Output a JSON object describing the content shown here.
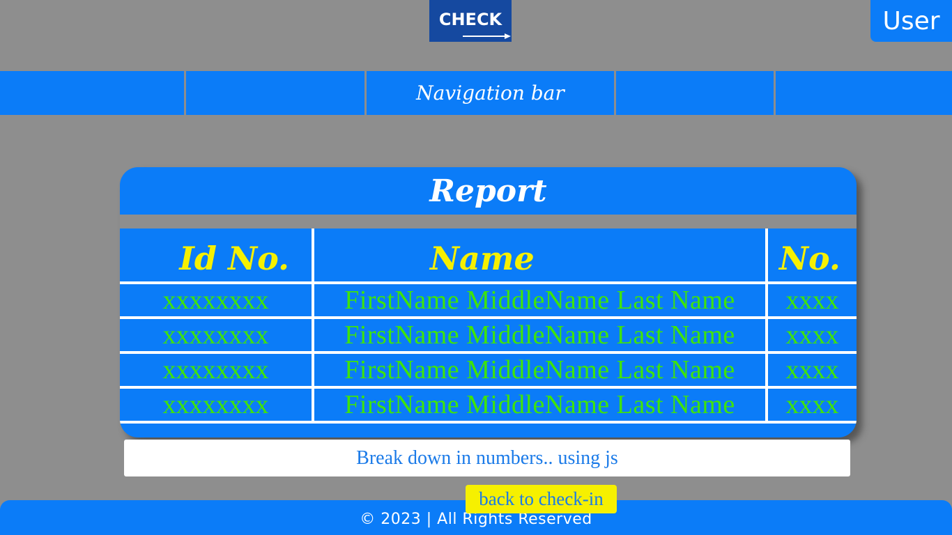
{
  "header": {
    "logo_text": "CHECK",
    "user_label": "User"
  },
  "navbar": {
    "items": [
      "",
      "",
      "Navigation bar",
      "",
      ""
    ]
  },
  "report": {
    "title": "Report",
    "columns": [
      "Id No.",
      "Name",
      "No."
    ],
    "rows": [
      [
        "xxxxxxxx",
        "FirstName MiddleName Last Name",
        "xxxx"
      ],
      [
        "xxxxxxxx",
        "FirstName MiddleName Last Name",
        "xxxx"
      ],
      [
        "xxxxxxxx",
        "FirstName MiddleName Last Name",
        "xxxx"
      ],
      [
        "xxxxxxxx",
        "FirstName MiddleName Last Name",
        "xxxx"
      ]
    ]
  },
  "breakdown": {
    "text": "Break down in numbers.. using js"
  },
  "actions": {
    "back_label": "back to check-in"
  },
  "footer": {
    "copyright": "© 2023 | All Rights Reserved"
  },
  "colors": {
    "background": "#8e8e8e",
    "primary_blue": "#0b7cf8",
    "logo_blue": "#1549a0",
    "header_yellow": "#f6f000",
    "cell_green": "#3fe40a"
  }
}
